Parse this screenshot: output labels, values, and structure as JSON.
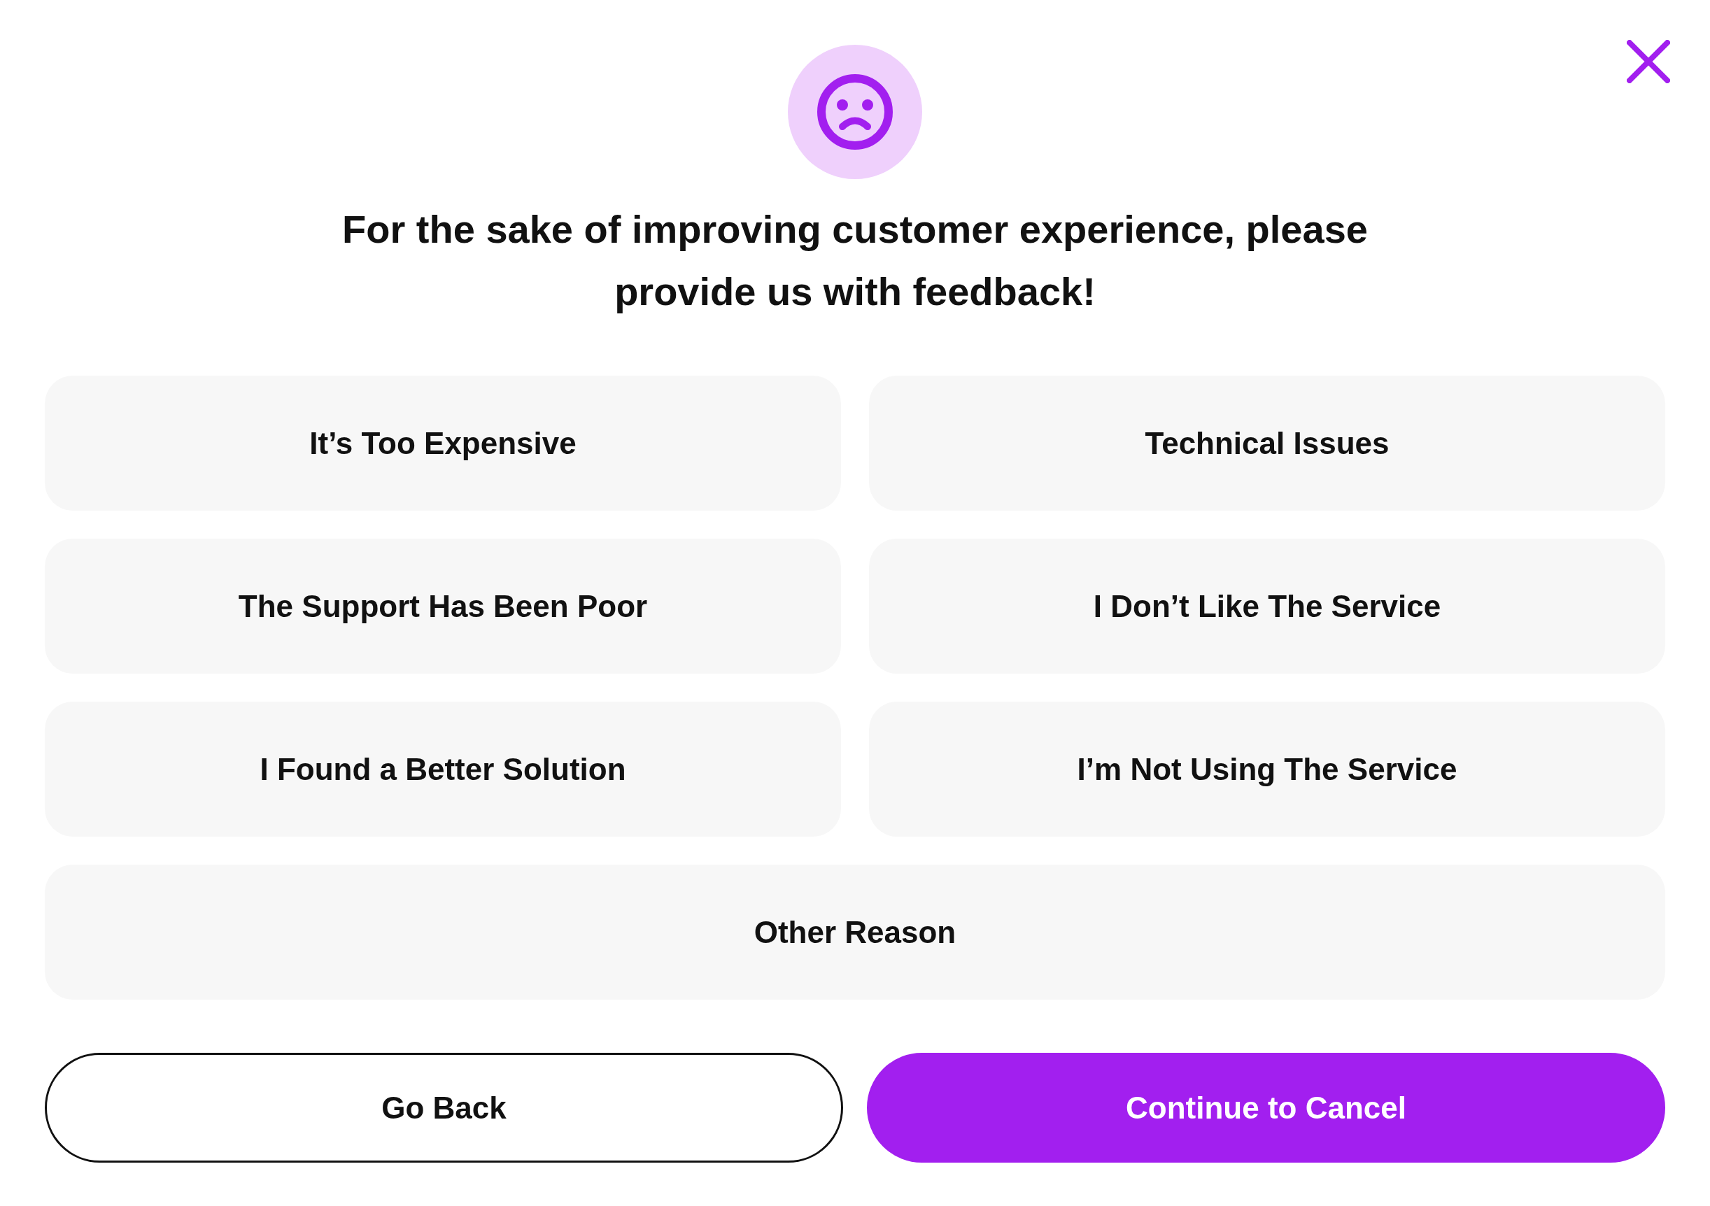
{
  "header": {
    "title": "For the sake of improving customer experience, please provide us with feedback!"
  },
  "reasons": [
    {
      "label": "It’s Too Expensive",
      "selected": false
    },
    {
      "label": "Technical Issues",
      "selected": false
    },
    {
      "label": "The Support Has Been Poor",
      "selected": false
    },
    {
      "label": "I Don’t Like The Service",
      "selected": false
    },
    {
      "label": "I Found a Better Solution",
      "selected": false
    },
    {
      "label": "I’m Not Using The Service",
      "selected": false
    },
    {
      "label": "Other Reason",
      "selected": false
    }
  ],
  "actions": [
    {
      "label": "Go Back",
      "kind": "secondary"
    },
    {
      "label": "Continue to Cancel",
      "kind": "primary"
    }
  ]
}
